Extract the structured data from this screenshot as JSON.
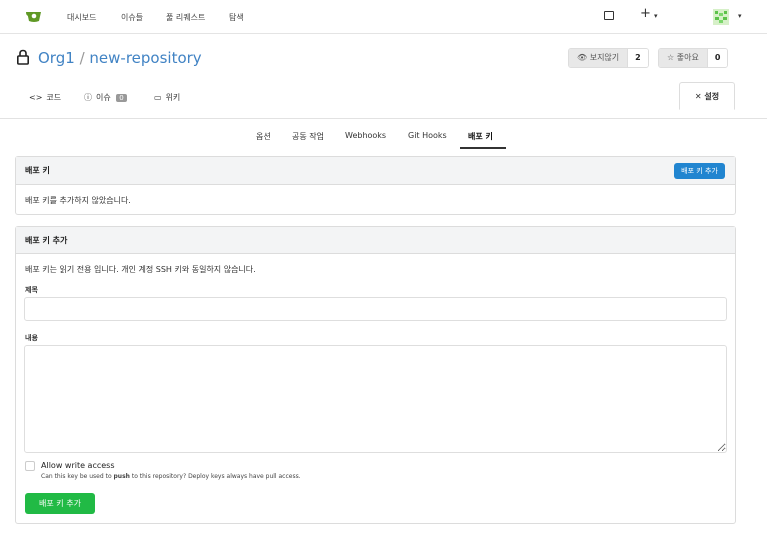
{
  "nav": {
    "items": [
      {
        "label": "대시보드"
      },
      {
        "label": "이슈들"
      },
      {
        "label": "풀 리퀘스트"
      },
      {
        "label": "탐색"
      }
    ],
    "plus_label": "+",
    "caret": "▾"
  },
  "repo": {
    "owner": "Org1",
    "separator": "/",
    "name": "new-repository",
    "watch_label": "보지않기",
    "watch_count": "2",
    "star_label": "좋아요",
    "star_count": "0"
  },
  "tabs": {
    "code": "코드",
    "issues": "이슈",
    "issues_count": "0",
    "wiki": "위키",
    "settings": "설정"
  },
  "subtabs": {
    "options": "옵션",
    "collaboration": "공동 작업",
    "webhooks": "Webhooks",
    "githooks": "Git Hooks",
    "deploykeys": "배포 키"
  },
  "deploy_keys": {
    "title": "배포 키",
    "add_button": "배포 키 추가",
    "empty_text": "배포 키를 추가하지 않았습니다."
  },
  "add_form": {
    "title": "배포 키 추가",
    "description": "배포 키는 읽기 전용 입니다. 개인 계정 SSH 키와 동일하지 않습니다.",
    "title_label": "제목",
    "title_value": "",
    "content_label": "내용",
    "content_value": "",
    "write_access_label": "Allow write access",
    "help_prefix": "Can this key be used to ",
    "help_bold": "push",
    "help_suffix": " to this repository? Deploy keys always have pull access.",
    "submit": "배포 키 추가"
  },
  "colors": {
    "link": "#4183c4",
    "primary": "#2185d0",
    "success": "#21ba45"
  }
}
